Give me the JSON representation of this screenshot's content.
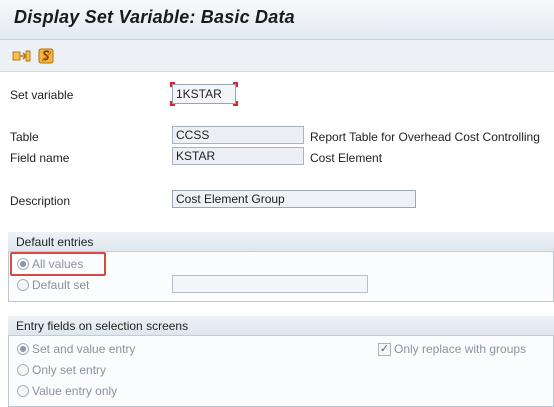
{
  "window": {
    "title": "Display Set Variable: Basic Data"
  },
  "toolbar": {
    "buttons": [
      {
        "name": "other-object",
        "icon": "other-object-icon"
      },
      {
        "name": "display-change",
        "icon": "display-change-icon"
      }
    ]
  },
  "form": {
    "set_variable": {
      "label": "Set variable",
      "value": "1KSTAR"
    },
    "table": {
      "label": "Table",
      "value": "CCSS",
      "text": "Report Table for Overhead Cost Controlling"
    },
    "field_name": {
      "label": "Field name",
      "value": "KSTAR",
      "text": "Cost Element"
    },
    "description": {
      "label": "Description",
      "value": "Cost Element Group"
    }
  },
  "default_entries": {
    "header": "Default entries",
    "all_values": {
      "label": "All values",
      "selected": true
    },
    "default_set": {
      "label": "Default set",
      "value": ""
    }
  },
  "entry_fields": {
    "header": "Entry fields on selection screens",
    "options": [
      {
        "label": "Set and value entry",
        "selected": true
      },
      {
        "label": "Only set entry",
        "selected": false
      },
      {
        "label": "Value entry only",
        "selected": false
      }
    ],
    "only_replace": {
      "label": "Only replace with groups",
      "checked": true
    }
  },
  "colors": {
    "highlight": "#d84848",
    "title_bar": "#e3e9f1",
    "toolbar_icon": "#f0a11a"
  }
}
